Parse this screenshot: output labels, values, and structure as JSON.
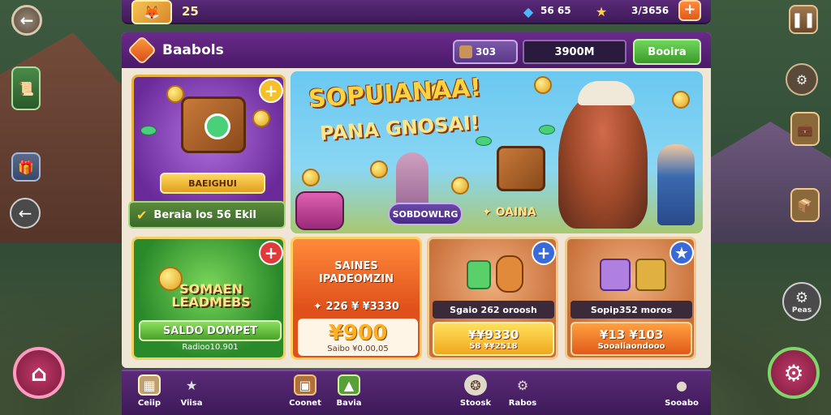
{
  "topbar": {
    "level": "25",
    "gems": "56 65",
    "stars": "3/3656",
    "add": "+"
  },
  "header": {
    "title": "Baabols",
    "currency_chip": "303",
    "balance": "3900M",
    "green_button": "Booira"
  },
  "cards": {
    "chest": {
      "ribbon": "BAEIGHUI",
      "footer": "Beraia los 56 Ekil",
      "plus": "+"
    },
    "banner": {
      "title": "SOPUIANAA!",
      "subtitle": "PANA GNOSAI!",
      "pill": "SOBDOWLRG",
      "tag": "✦ OAINA"
    },
    "leader": {
      "title": "SOMAEN LEADMEBS",
      "button": "SALDO DOMPET",
      "sub": "Radioo10.901",
      "plus": "+"
    },
    "deal": {
      "title": "SAINES IPADEOMZIN",
      "line": "✦ 226 ¥ ¥3330",
      "price": "¥900",
      "note": "Saibo ¥0.00,05"
    },
    "offer1": {
      "strip": "Sgaio 262 oroosh",
      "price": "¥¥9330",
      "sub": "58 ¥¥2518",
      "plus": "+"
    },
    "offer2": {
      "strip": "Sopip352 moros",
      "price": "¥13 ¥103",
      "sub": "Sooaliaondooo",
      "plus": "★"
    }
  },
  "side": {
    "right_bottom_label": "Peas"
  },
  "nav": [
    {
      "label": "Ceiip",
      "icon": "card-icon"
    },
    {
      "label": "Viisa",
      "icon": "star-icon"
    },
    {
      "label": "Coonet",
      "icon": "crate-icon"
    },
    {
      "label": "Bavia",
      "icon": "trophy-icon"
    },
    {
      "label": "Stoosk",
      "icon": "compass-icon"
    },
    {
      "label": "Rabos",
      "icon": "gear-icon"
    },
    {
      "label": "Sooabo",
      "icon": "profile-icon"
    }
  ]
}
